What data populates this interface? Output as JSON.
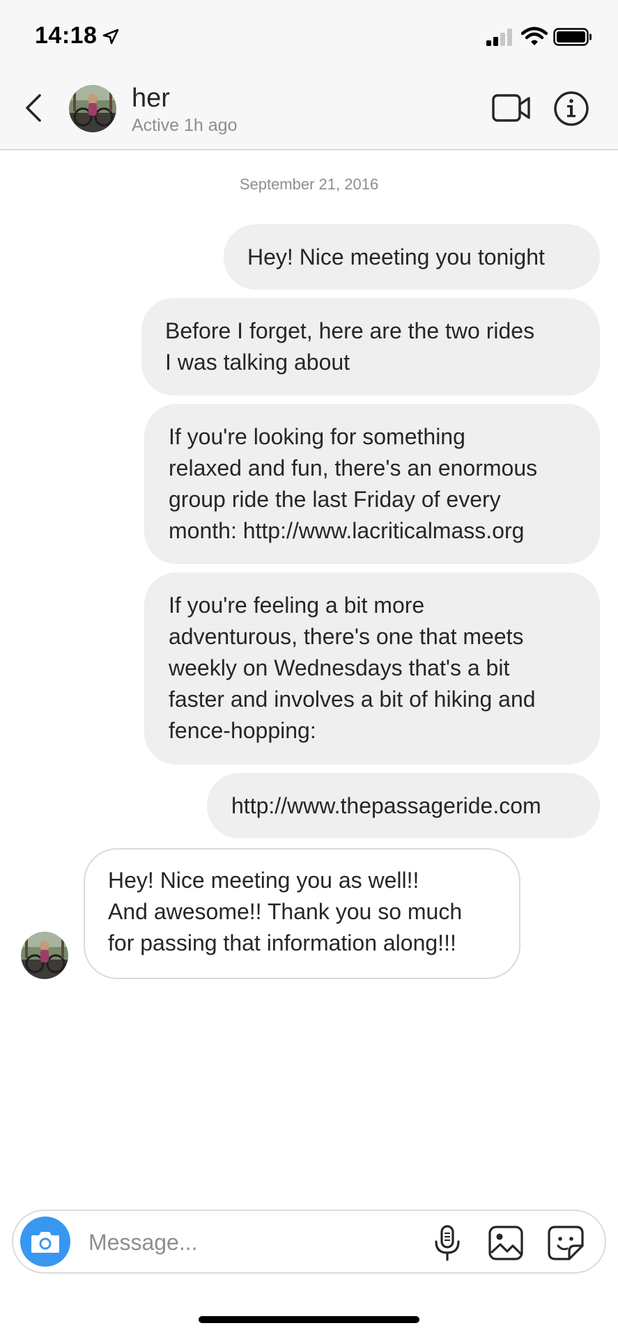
{
  "status_bar": {
    "time": "14:18"
  },
  "header": {
    "contact_name": "her",
    "contact_status": "Active 1h ago"
  },
  "conversation": {
    "date": "September 21, 2016",
    "messages": [
      {
        "sender": "me",
        "lines": [
          "Hey! Nice meeting you tonight"
        ]
      },
      {
        "sender": "me",
        "lines": [
          "Before I forget, here are the two rides",
          "I was talking about"
        ]
      },
      {
        "sender": "me",
        "lines": [
          "If you're looking for something",
          "relaxed and fun, there's an enormous",
          "group ride the last Friday of every",
          "month: http://www.lacriticalmass.org"
        ]
      },
      {
        "sender": "me",
        "lines": [
          "If you're feeling a bit more",
          "adventurous, there's one that meets",
          "weekly on Wednesdays that's a bit",
          "faster and involves a bit of hiking and",
          "fence-hopping:"
        ]
      },
      {
        "sender": "me",
        "lines": [
          "http://www.thepassageride.com"
        ]
      },
      {
        "sender": "her",
        "lines": [
          "Hey! Nice meeting you as well!!",
          "And awesome!! Thank you so much",
          "for passing that information along!!!"
        ]
      }
    ]
  },
  "composer": {
    "placeholder": "Message..."
  },
  "colors": {
    "accent": "#3897f0",
    "outgoing_bubble": "#efefef",
    "border": "#dbdbdb",
    "secondary_text": "#8e8e8e"
  },
  "icons": [
    "location-arrow-icon",
    "signal-icon",
    "wifi-icon",
    "battery-icon",
    "chevron-left-icon",
    "video-camera-icon",
    "info-icon",
    "camera-icon",
    "microphone-icon",
    "gallery-icon",
    "sticker-icon"
  ]
}
